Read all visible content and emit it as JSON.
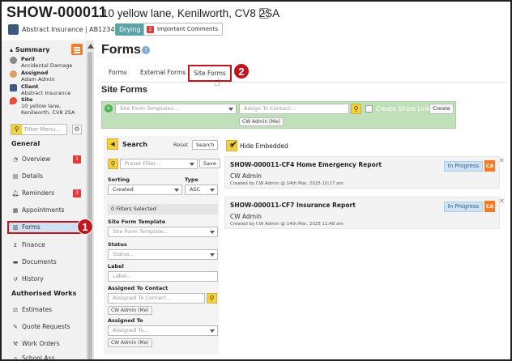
{
  "header": {
    "job_id": "SHOW-000011",
    "address": "10 yellow lane, Kenilworth, CV8 2SA",
    "insurer": "Abstract Insurance | AB123456",
    "status_badge": "Drying",
    "important_count": "2",
    "important_label": "Important Comments"
  },
  "sidebar": {
    "summary_label": "Summary",
    "summary": [
      {
        "title": "Peril",
        "value": "Accidental Damage",
        "color": "#888888"
      },
      {
        "title": "Assigned",
        "value": "Adam Admin",
        "color": "#d9a066"
      },
      {
        "title": "Client",
        "value": "Abstract Insurance",
        "color": "#3d5a80"
      },
      {
        "title": "Site",
        "value": "10 yellow lane,",
        "value2": "Kenilworth, CV8 2SA",
        "color": "#e74c3c"
      }
    ],
    "filter_placeholder": "Filter Menu...",
    "general_label": "General",
    "general_items": [
      {
        "label": "Overview",
        "icon": "dashboard-icon",
        "count": "1"
      },
      {
        "label": "Details",
        "icon": "document-icon",
        "count": ""
      },
      {
        "label": "Reminders",
        "icon": "bell-icon",
        "count": "3"
      },
      {
        "label": "Appointments",
        "icon": "calendar-icon",
        "count": ""
      },
      {
        "label": "Forms",
        "icon": "forms-icon",
        "count": ""
      },
      {
        "label": "Finance",
        "icon": "pound-icon",
        "count": ""
      },
      {
        "label": "Documents",
        "icon": "folder-icon",
        "count": ""
      },
      {
        "label": "History",
        "icon": "history-icon",
        "count": ""
      }
    ],
    "authorised_label": "Authorised Works",
    "authorised_items": [
      {
        "label": "Estimates",
        "icon": "scale-icon"
      },
      {
        "label": "Quote Requests",
        "icon": "wrench-icon"
      },
      {
        "label": "Work Orders",
        "icon": "hammer-icon"
      },
      {
        "label": "School Ass...",
        "icon": "school-icon"
      }
    ]
  },
  "main": {
    "title": "Forms",
    "tabs": [
      "Forms",
      "External Forms",
      "Site Forms"
    ],
    "active_tab": "Site Forms",
    "section_title": "Site Forms",
    "template_placeholder": "Site Form Templates...",
    "assign_placeholder": "Assign To Contact...",
    "assign_chip": "CW Admin (Me)",
    "share_label": "Create Share Link",
    "create_label": "Create"
  },
  "search": {
    "title": "Search",
    "reset": "Reset",
    "search_btn": "Search",
    "preset_placeholder": "Preset Filter...",
    "save": "Save",
    "sorting_label": "Sorting",
    "sorting_value": "Created",
    "type_label": "Type",
    "type_value": "ASC",
    "filters_selected": "0 Filters Selected",
    "template_label": "Site Form Template",
    "template_placeholder": "Site Form Template...",
    "status_label": "Status",
    "status_placeholder": "Status...",
    "label_label": "Label",
    "label_placeholder": "Label...",
    "assigned_contact_label": "Assigned To Contact",
    "assigned_contact_placeholder": "Assigned To Contact...",
    "assigned_contact_chip": "CW Admin (Me)",
    "assigned_to_label": "Assigned To",
    "assigned_to_placeholder": "Assigned To...",
    "assigned_to_chip": "CW Admin (Me)"
  },
  "results": {
    "hide_embedded": "Hide Embedded",
    "forms": [
      {
        "title": "SHOW-000011-CF4 Home Emergency Report",
        "user": "CW Admin",
        "meta": "Created by CW Admin @ 14th Mar, 2025 10:17 am",
        "status": "In Progress",
        "initials": "CA"
      },
      {
        "title": "SHOW-000011-CF7 Insurance Report",
        "user": "CW Admin",
        "meta": "Created by CW Admin @ 14th Mar, 2025 11:48 am",
        "status": "In Progress",
        "initials": "CA"
      }
    ]
  },
  "callouts": [
    "1",
    "2"
  ],
  "colors": {
    "accent": "#f07c28",
    "callout": "#c0171e",
    "green_bar": "#bfe0b9",
    "status_bg": "#cfe3f5"
  }
}
